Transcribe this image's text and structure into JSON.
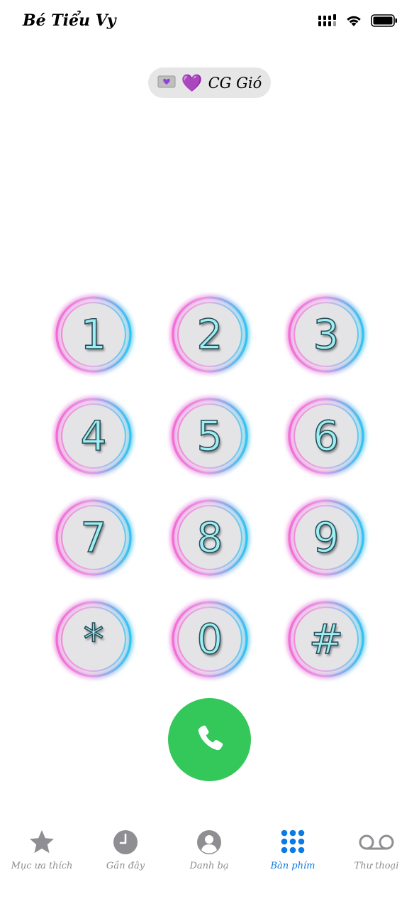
{
  "status_bar": {
    "carrier": "Bé Tiểu Vy"
  },
  "sim": {
    "emoji": "💜",
    "label": "CG Gió"
  },
  "keypad": {
    "keys": [
      "1",
      "2",
      "3",
      "4",
      "5",
      "6",
      "7",
      "8",
      "9",
      "*",
      "0",
      "#"
    ]
  },
  "tabs": [
    {
      "label": "Mục ưa thích",
      "icon": "star-icon",
      "active": false
    },
    {
      "label": "Gần đây",
      "icon": "clock-icon",
      "active": false
    },
    {
      "label": "Danh bạ",
      "icon": "person-icon",
      "active": false
    },
    {
      "label": "Bàn phím",
      "icon": "keypad-icon",
      "active": true
    },
    {
      "label": "Thư thoại",
      "icon": "voicemail-icon",
      "active": false
    }
  ],
  "colors": {
    "call_green": "#34c759",
    "active_blue": "#0a7ae6",
    "inactive_gray": "#8e8e93",
    "key_ring_pink": "#f06ad8",
    "key_ring_blue": "#2fc3f0",
    "key_digit": "#9eeff3"
  }
}
